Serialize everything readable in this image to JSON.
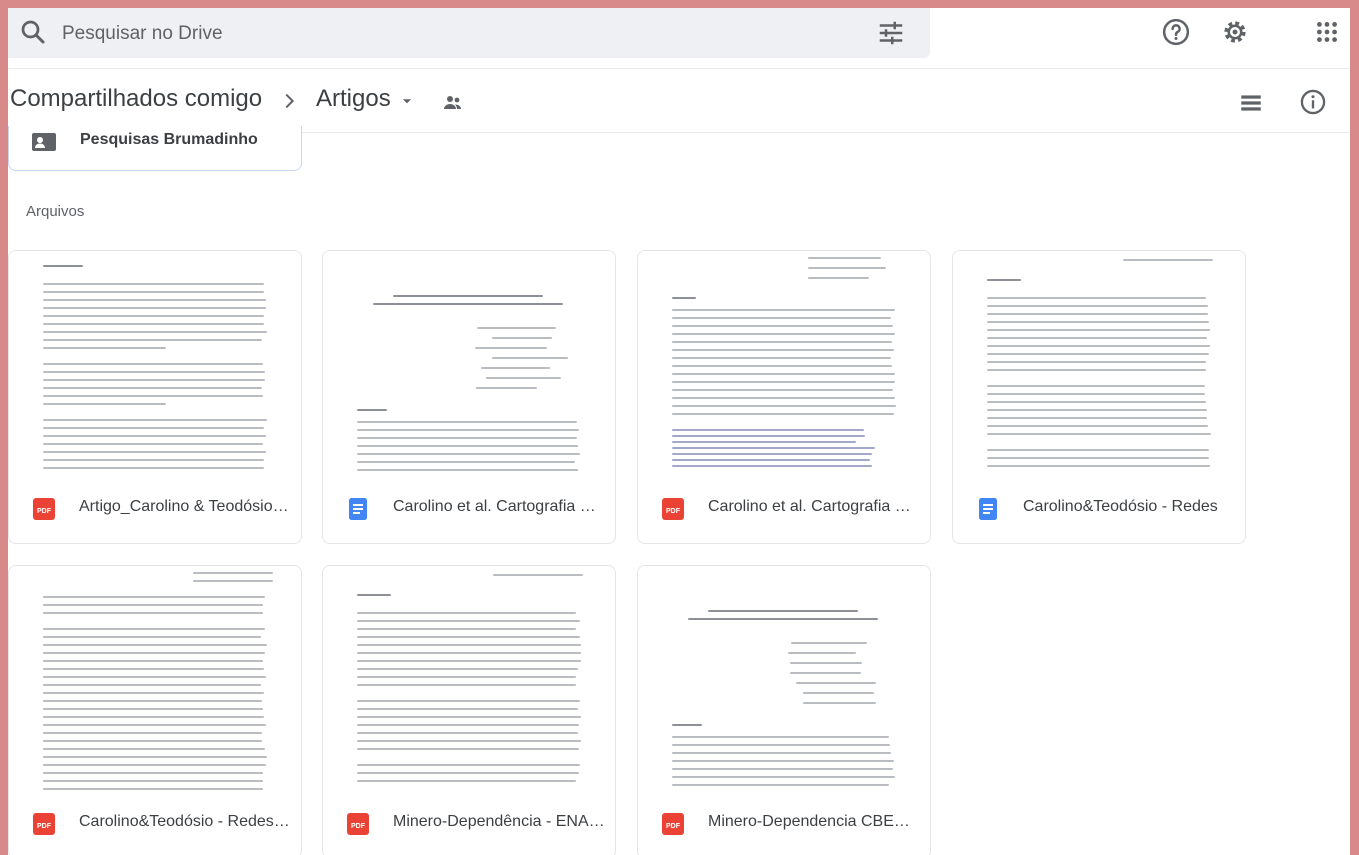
{
  "search": {
    "placeholder": "Pesquisar no Drive"
  },
  "topbar": {
    "search_icon": "search-icon",
    "filter_icon": "tune-icon",
    "help_icon": "help-icon",
    "settings_icon": "gear-icon",
    "apps_icon": "grid-icon"
  },
  "breadcrumb": {
    "parent": "Compartilhados comigo",
    "separator": ">",
    "current": "Artigos",
    "dropdown_icon": "caret-down-icon",
    "shared_icon": "people-icon",
    "view_icon": "list-view-icon",
    "info_icon": "info-icon"
  },
  "folders": [
    {
      "name": "Pesquisas Brumadinho",
      "icon": "shared-folder-icon"
    }
  ],
  "sections": {
    "files": "Arquivos"
  },
  "files": [
    {
      "name": "Artigo_Carolino & Teodósio.pdf",
      "type": "pdf",
      "type_label": "PDF"
    },
    {
      "name": "Carolino et al. Cartografia Social",
      "type": "doc",
      "type_label": "DOC"
    },
    {
      "name": "Carolino et al. Cartografia Social.pdf",
      "type": "pdf",
      "type_label": "PDF"
    },
    {
      "name": "Carolino&Teodósio - Redes",
      "type": "doc",
      "type_label": "DOC"
    },
    {
      "name": "Carolino&Teodósio - Redes.pdf",
      "type": "pdf",
      "type_label": "PDF"
    },
    {
      "name": "Minero-Dependência - ENANPAD.pdf",
      "type": "pdf",
      "type_label": "PDF"
    },
    {
      "name": "Minero-Dependencia CBEO.pdf",
      "type": "pdf",
      "type_label": "PDF"
    }
  ],
  "colors": {
    "pdf": "#ea4335",
    "doc": "#4285f4",
    "accent_border": "#c6d7f4",
    "frame": "#d88a8a"
  }
}
